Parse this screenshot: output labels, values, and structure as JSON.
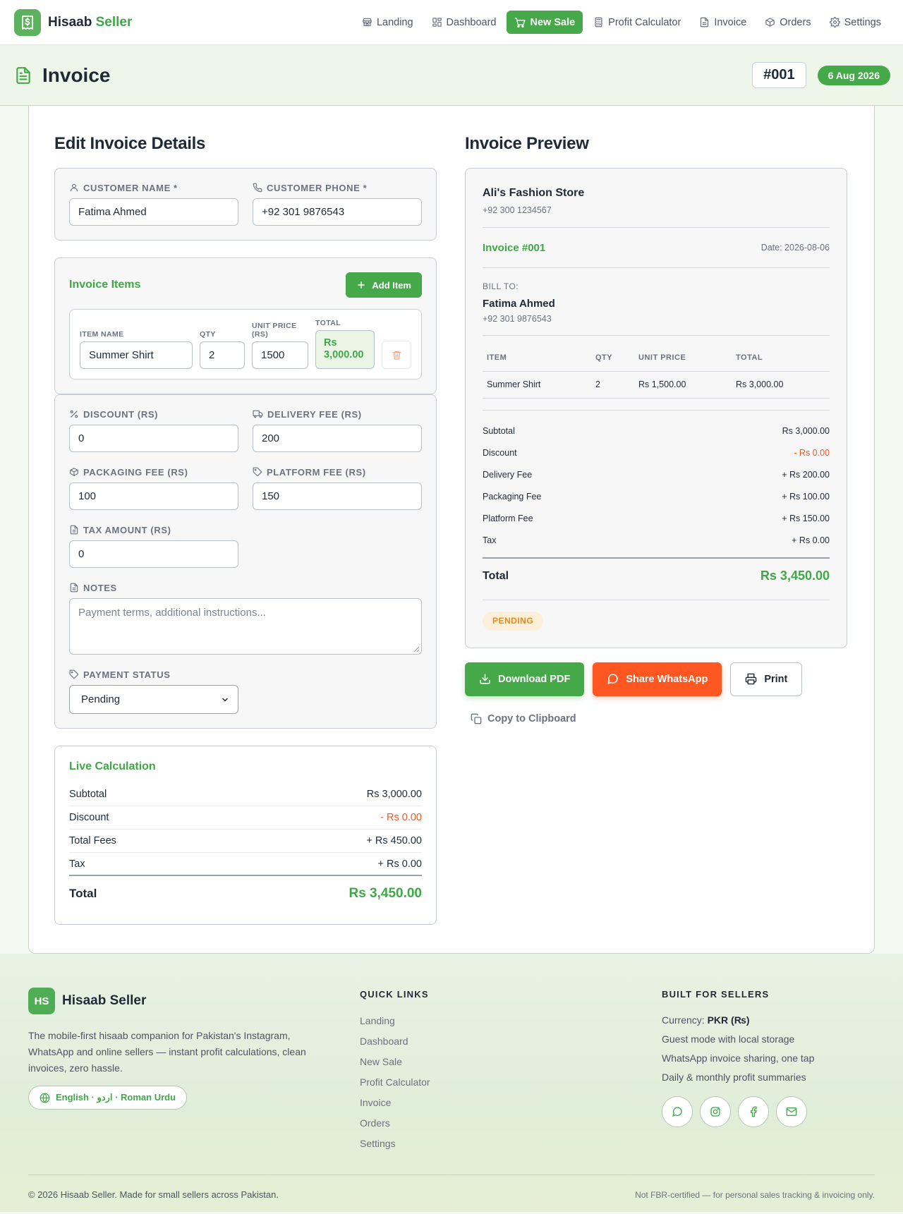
{
  "app": {
    "name_main": "Hisaab",
    "name_accent": "Seller"
  },
  "nav": [
    {
      "label": "Landing",
      "icon": "store-icon"
    },
    {
      "label": "Dashboard",
      "icon": "dashboard-icon"
    },
    {
      "label": "New Sale",
      "icon": "cart-icon",
      "active": true
    },
    {
      "label": "Profit Calculator",
      "icon": "calculator-icon"
    },
    {
      "label": "Invoice",
      "icon": "file-icon"
    },
    {
      "label": "Orders",
      "icon": "box-icon"
    },
    {
      "label": "Settings",
      "icon": "gear-icon"
    }
  ],
  "page": {
    "title": "Invoice",
    "invoice_no": "#001",
    "date": "6 Aug 2026"
  },
  "editor": {
    "title": "Edit Invoice Details",
    "customer_name_label": "CUSTOMER NAME *",
    "customer_name": "Fatima Ahmed",
    "customer_phone_label": "CUSTOMER PHONE *",
    "customer_phone": "+92 301 9876543",
    "items_title": "Invoice Items",
    "add_item": "Add Item",
    "item_cols": {
      "name": "ITEM NAME",
      "qty": "QTY",
      "unit_price": "UNIT PRICE (RS)",
      "total": "TOTAL"
    },
    "item": {
      "name": "Summer Shirt",
      "qty": "2",
      "unit_price": "1500",
      "total": "Rs 3,000.00"
    },
    "discount_label": "DISCOUNT (RS)",
    "discount": "0",
    "delivery_label": "DELIVERY FEE (RS)",
    "delivery": "200",
    "packaging_label": "PACKAGING FEE (RS)",
    "packaging": "100",
    "platform_label": "PLATFORM FEE (RS)",
    "platform": "150",
    "tax_label": "TAX AMOUNT (RS)",
    "tax": "0",
    "notes_label": "NOTES",
    "notes_placeholder": "Payment terms, additional instructions...",
    "status_label": "PAYMENT STATUS",
    "status": "Pending"
  },
  "live": {
    "title": "Live Calculation",
    "rows": [
      {
        "label": "Subtotal",
        "value": "Rs 3,000.00"
      },
      {
        "label": "Discount",
        "value": "- Rs 0.00"
      },
      {
        "label": "Total Fees",
        "value": "+ Rs 450.00"
      },
      {
        "label": "Tax",
        "value": "+ Rs 0.00"
      }
    ],
    "total_label": "Total",
    "total_value": "Rs 3,450.00"
  },
  "preview": {
    "title": "Invoice Preview",
    "store": "Ali's Fashion Store",
    "store_phone": "+92 300 1234567",
    "invoice_label": "Invoice #001",
    "date": "Date: 2026-08-06",
    "bill_to": "BILL TO:",
    "customer": "Fatima Ahmed",
    "customer_phone": "+92 301 9876543",
    "cols": [
      "ITEM",
      "QTY",
      "UNIT PRICE",
      "TOTAL"
    ],
    "rows": [
      [
        "Summer Shirt",
        "2",
        "Rs 1,500.00",
        "Rs 3,000.00"
      ]
    ],
    "summary": [
      {
        "label": "Subtotal",
        "value": "Rs 3,000.00"
      },
      {
        "label": "Discount",
        "value": "- Rs 0.00"
      },
      {
        "label": "Delivery Fee",
        "value": "+ Rs 200.00"
      },
      {
        "label": "Packaging Fee",
        "value": "+ Rs 100.00"
      },
      {
        "label": "Platform Fee",
        "value": "+ Rs 150.00"
      },
      {
        "label": "Tax",
        "value": "+ Rs 0.00"
      }
    ],
    "total_label": "Total",
    "total_value": "Rs 3,450.00",
    "status": "PENDING"
  },
  "actions": {
    "download": "Download PDF",
    "whatsapp": "Share WhatsApp",
    "print": "Print",
    "copy": "Copy to Clipboard"
  },
  "footer": {
    "logo": "HS",
    "brand": "Hisaab Seller",
    "desc": "The mobile-first hisaab companion for Pakistan's Instagram, WhatsApp and online sellers — instant profit calculations, clean invoices, zero hassle.",
    "lang": "English · اردو · Roman Urdu",
    "quick_title": "QUICK LINKS",
    "quick_links": [
      "Landing",
      "Dashboard",
      "New Sale",
      "Profit Calculator",
      "Invoice",
      "Orders",
      "Settings"
    ],
    "built_title": "BUILT FOR SELLERS",
    "currency_label": "Currency:",
    "currency_value": "PKR (₨)",
    "built_lines": [
      "Guest mode with local storage",
      "WhatsApp invoice sharing, one tap",
      "Daily & monthly profit summaries"
    ],
    "copyright": "© 2026 Hisaab Seller. Made for small sellers across Pakistan.",
    "note": "Not FBR-certified — for personal sales tracking & invoicing only."
  },
  "colors": {
    "brand_green": "#45a94a",
    "accent_orange": "#ff5722",
    "danger": "#f05a23",
    "pending": "#e58a1f"
  }
}
